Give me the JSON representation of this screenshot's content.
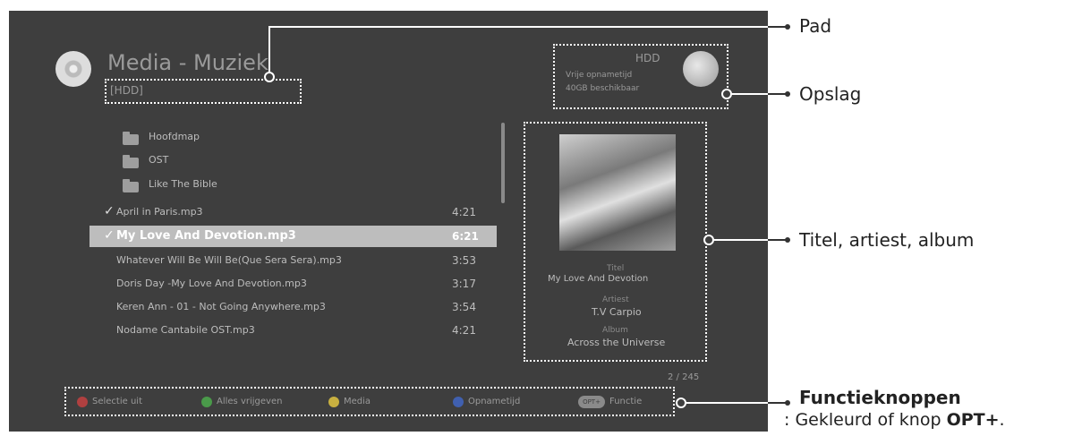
{
  "header": {
    "title": "Media - Muziek",
    "path": "[HDD]"
  },
  "storage": {
    "name": "HDD",
    "line1": "Vrije opnametijd",
    "line2": "40GB beschikbaar"
  },
  "file_list": [
    {
      "type": "folder",
      "name": "Hoofdmap",
      "time": ""
    },
    {
      "type": "folder",
      "name": "OST",
      "time": ""
    },
    {
      "type": "folder",
      "name": "Like The Bible",
      "time": ""
    },
    {
      "type": "file",
      "name": "April in Paris.mp3",
      "time": "4:21",
      "checked": true
    },
    {
      "type": "file",
      "name": "My Love And Devotion.mp3",
      "time": "6:21",
      "checked": true,
      "selected": true
    },
    {
      "type": "file",
      "name": "Whatever Will Be Will Be(Que Sera Sera).mp3",
      "time": "3:53"
    },
    {
      "type": "file",
      "name": "Doris Day -My Love And Devotion.mp3",
      "time": "3:17"
    },
    {
      "type": "file",
      "name": "Keren Ann - 01 - Not Going Anywhere.mp3",
      "time": "3:54"
    },
    {
      "type": "file",
      "name": "Nodame Cantabile OST.mp3",
      "time": "4:21"
    }
  ],
  "info_panel": {
    "title_label": "Titel",
    "title_value": "My Love And Devotion",
    "artist_label": "Artiest",
    "artist_value": "T.V Carpio",
    "album_label": "Album",
    "album_value": "Across the Universe"
  },
  "page_counter": "2 / 245",
  "function_bar": [
    {
      "label": "Selectie uit",
      "color": "#b04040"
    },
    {
      "label": "Alles vrijgeven",
      "color": "#4a9a4a"
    },
    {
      "label": "Media",
      "color": "#c8b040"
    },
    {
      "label": "Opnametijd",
      "color": "#4060b0"
    },
    {
      "label": "Functie",
      "key": "OPT+"
    }
  ],
  "callouts": {
    "path": "Pad",
    "storage": "Opslag",
    "info": "Titel, artiest, album",
    "functions_title": "Functieknoppen",
    "functions_sub_prefix": ": Gekleurd of knop ",
    "functions_sub_key": "OPT+",
    "functions_sub_suffix": "."
  }
}
